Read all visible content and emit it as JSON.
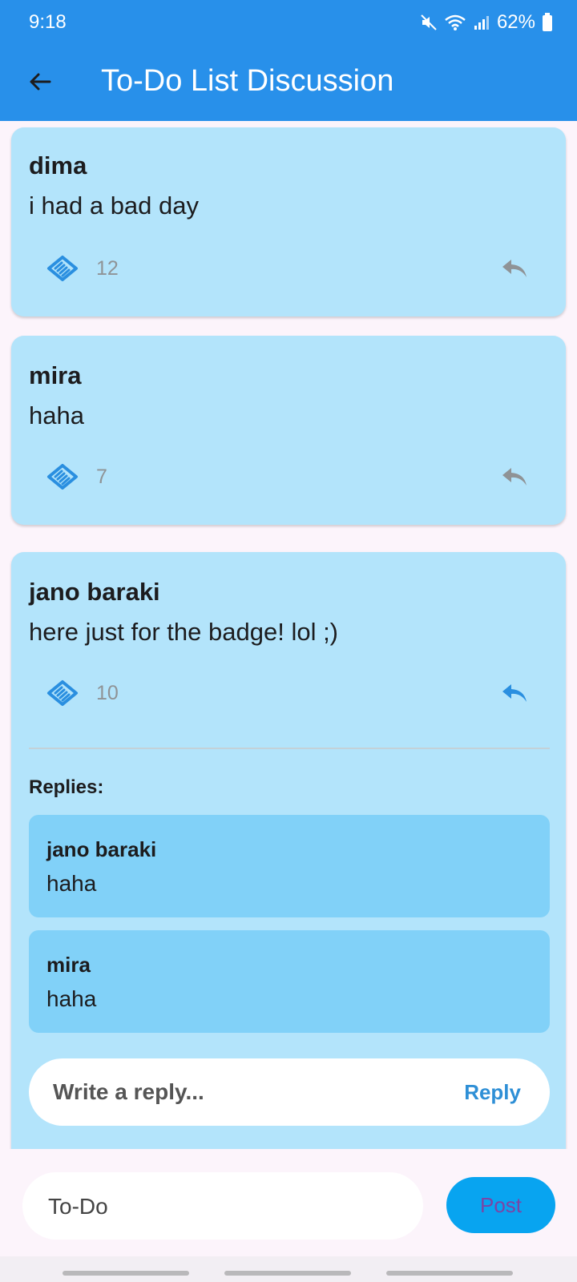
{
  "status_bar": {
    "time": "9:18",
    "battery": "62%"
  },
  "appbar": {
    "title": "To-Do List Discussion"
  },
  "posts": [
    {
      "author": "dima",
      "message": "i had a bad day",
      "likes": "12"
    },
    {
      "author": "mira",
      "message": "haha",
      "likes": "7"
    },
    {
      "author": "jano baraki",
      "message": "here just for the badge! lol ;)",
      "likes": "10",
      "replies_label": "Replies:",
      "replies": [
        {
          "author": "jano baraki",
          "text": "haha"
        },
        {
          "author": "mira",
          "text": "haha"
        }
      ],
      "reply_placeholder": "Write a reply...",
      "reply_button": "Reply"
    }
  ],
  "composer": {
    "placeholder": "To-Do",
    "post_button": "Post"
  },
  "colors": {
    "appbar": "#2890ea",
    "card": "#b3e4fb",
    "reply_card": "#81d1f8",
    "accent": "#2e8fd6",
    "post_button": "#08a4f0"
  },
  "icons": {
    "back": "arrow-left-icon",
    "like": "handshake-icon",
    "reply": "reply-arrow-icon"
  }
}
